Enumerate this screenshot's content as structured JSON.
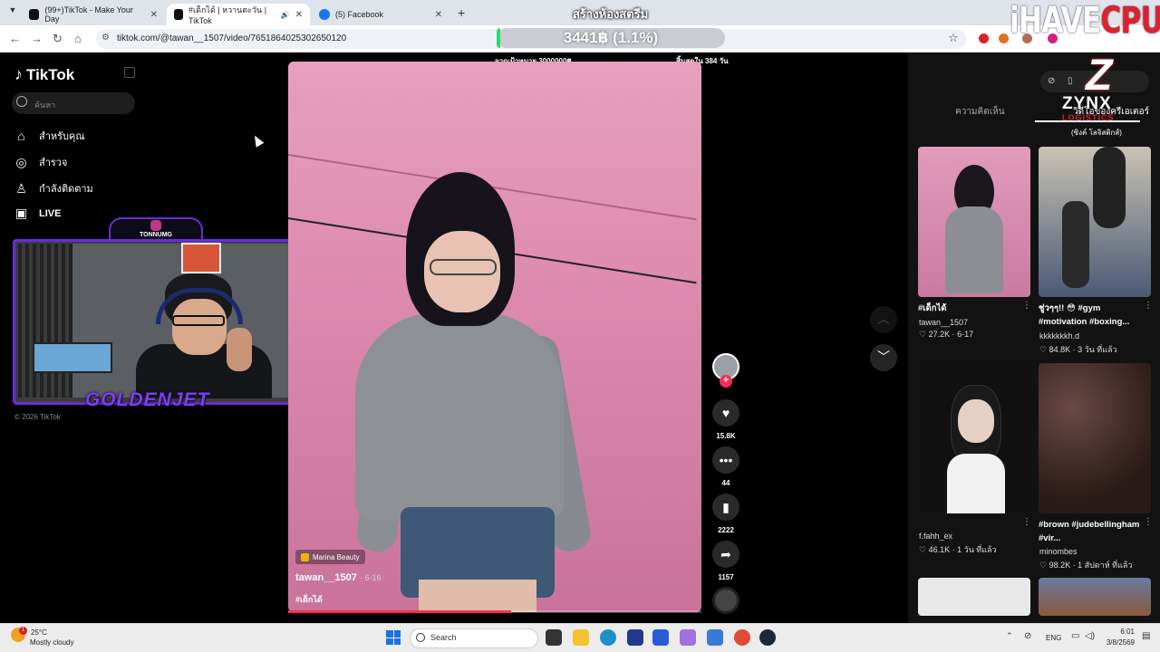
{
  "browser": {
    "tabs": [
      {
        "title": "(99+)TikTok - Make Your Day"
      },
      {
        "title": "#เด็กได้ | หวานตะวัน | TikTok"
      },
      {
        "title": "(5) Facebook"
      }
    ],
    "new_tab": "+",
    "url": "tiktok.com/@tawan__1507/video/7651864025302650120"
  },
  "stream_overlay": {
    "title": "สร้างห้องสตรีม",
    "amount": "3441฿ (1.1%)",
    "progress_fraction": 0.011,
    "goal": "จากเป้าหมาย 3000000฿",
    "ends": "สิ้นสุดใน 384 วัน",
    "brand_prefix": "iHAVE",
    "brand_suffix": "CPU",
    "sponsor": {
      "name": "ZYNX",
      "sub": "LOGISTICS",
      "thai": "(ซิงค์ โลจิสติกส์)",
      "letter": "Z"
    },
    "webcam": {
      "name": "TONNUMG",
      "tag": "GOLDENJET"
    }
  },
  "tiktok": {
    "logo": "TikTok",
    "search_placeholder": "ค้นหา",
    "nav": [
      {
        "label": "สำหรับคุณ",
        "icon": "home-icon"
      },
      {
        "label": "สำรวจ",
        "icon": "compass-icon"
      },
      {
        "label": "กำลังติดตาม",
        "icon": "following-icon"
      },
      {
        "label": "LIVE",
        "icon": "live-icon"
      }
    ],
    "copyright": "© 2026 TikTok",
    "video": {
      "badge": "Marina Beauty",
      "author": "tawan__1507",
      "date": "· 6-16",
      "tag": "#เด็กได้",
      "progress_fraction": 0.54
    },
    "actions": {
      "likes": "15.8K",
      "comments": "44",
      "saves": "2222",
      "shares": "1157"
    },
    "panel": {
      "tab_comments": "ความคิดเห็น",
      "tab_creator": "วิดีโอของครีเอเตอร์"
    },
    "related": [
      {
        "title": "#เด็กได้",
        "author": "tawan__1507",
        "meta": "♡ 27.2K · 6-17"
      },
      {
        "title": "ชู่วๆๆ!! 😳 #gym #motivation #boxing...",
        "author": "kkkkkkkh.d",
        "meta": "♡ 84.8K · 3 วัน ที่แล้ว"
      },
      {
        "title": "",
        "author": "f.fahh_ex",
        "meta": "♡ 46.1K · 1 วัน ที่แล้ว"
      },
      {
        "title": "#brown #judebellingham #vir...",
        "author": "minombes",
        "meta": "♡ 98.2K · 1 สัปดาห์ ที่แล้ว"
      }
    ]
  },
  "taskbar": {
    "temp": "25°C",
    "condition": "Mostly cloudy",
    "weather_badge": "1",
    "search": "Search",
    "lang": "ENG",
    "time": "6:01",
    "date": "3/8/2569"
  }
}
